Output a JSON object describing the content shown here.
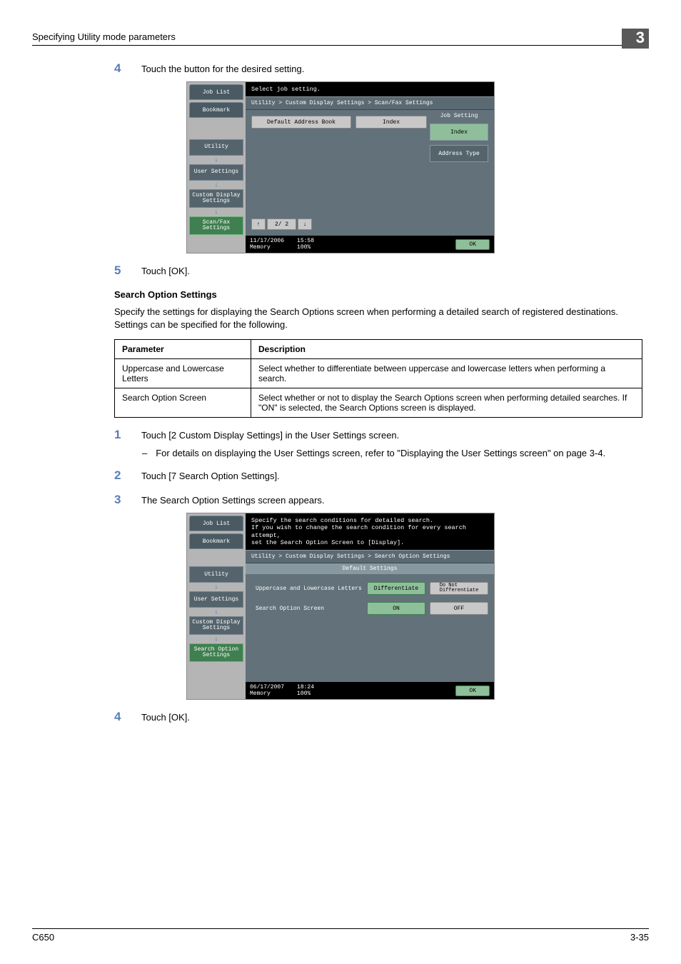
{
  "header": {
    "title": "Specifying Utility mode parameters",
    "chapter": "3"
  },
  "steps": {
    "s4a": {
      "num": "4",
      "text": "Touch the button for the desired setting."
    },
    "s5": {
      "num": "5",
      "text": "Touch [OK]."
    },
    "s1": {
      "num": "1",
      "text": "Touch [2 Custom Display Settings] in the User Settings screen."
    },
    "s1sub": "For details on displaying the User Settings screen, refer to \"Displaying the User Settings screen\" on page 3-4.",
    "s2": {
      "num": "2",
      "text": "Touch [7 Search Option Settings]."
    },
    "s3": {
      "num": "3",
      "text": "The Search Option Settings screen appears."
    },
    "s4b": {
      "num": "4",
      "text": "Touch [OK]."
    }
  },
  "section": {
    "heading": "Search Option Settings",
    "desc": "Specify the settings for displaying the Search Options screen when performing a detailed search of registered destinations. Settings can be specified for the following."
  },
  "table": {
    "h1": "Parameter",
    "h2": "Description",
    "rows": [
      {
        "p": "Uppercase and Lowercase Letters",
        "d": "Select whether to differentiate between uppercase and lowercase letters when performing a search."
      },
      {
        "p": "Search Option Screen",
        "d": "Select whether or not to display the Search Options screen when performing detailed searches. If \"ON\" is selected, the Search Options screen is displayed."
      }
    ]
  },
  "screen1": {
    "tabs": {
      "joblist": "Job List",
      "bookmark": "Bookmark"
    },
    "menu": {
      "utility": "Utility",
      "user": "User Settings",
      "custom": "Custom Display\nSettings",
      "scanfax": "Scan/Fax\nSettings"
    },
    "instr": "Select job setting.",
    "breadcrumb": "Utility > Custom Display Settings > Scan/Fax Settings",
    "opt": {
      "defaddr": "Default Address Book",
      "index": "Index"
    },
    "pager": {
      "up": "↑",
      "page": "2/ 2",
      "down": "↓"
    },
    "side": {
      "label": "Job Setting",
      "index": "Index",
      "addrtype": "Address Type"
    },
    "footer": {
      "date": "11/17/2006",
      "time": "15:58",
      "mem": "Memory",
      "pct": "100%",
      "ok": "OK"
    }
  },
  "screen2": {
    "tabs": {
      "joblist": "Job List",
      "bookmark": "Bookmark"
    },
    "menu": {
      "utility": "Utility",
      "user": "User Settings",
      "custom": "Custom Display\nSettings",
      "search": "Search Option\nSettings"
    },
    "instr": "Specify the search conditions for detailed search.\nIf you wish to change the search condition for every search attempt,\nset the Search Option Screen to [Display].",
    "breadcrumb": "Utility > Custom Display Settings > Search Option Settings",
    "defhdr": "Default Settings",
    "row1": {
      "label": "Uppercase and Lowercase Letters",
      "a": "Differentiate",
      "b": "Do Not\nDifferentiate"
    },
    "row2": {
      "label": "Search Option Screen",
      "a": "ON",
      "b": "OFF"
    },
    "footer": {
      "date": "06/17/2007",
      "time": "18:24",
      "mem": "Memory",
      "pct": "100%",
      "ok": "OK"
    }
  },
  "footer": {
    "left": "C650",
    "right": "3-35"
  }
}
